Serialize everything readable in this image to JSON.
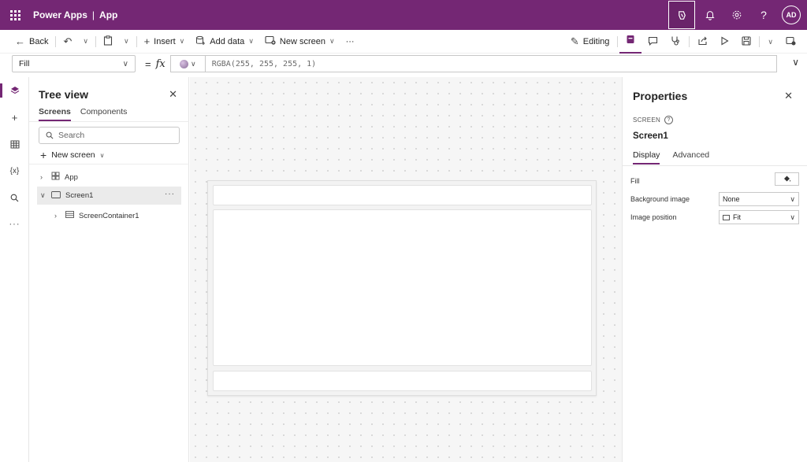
{
  "app": {
    "product": "Power Apps",
    "separator": "|",
    "name": "App",
    "user_initials": "AD"
  },
  "topbar_icons": [
    "copilot-icon",
    "bell-icon",
    "gear-icon",
    "help-icon"
  ],
  "toolbar": {
    "back": "Back",
    "insert": "Insert",
    "add_data": "Add data",
    "new_screen": "New screen",
    "more": "···",
    "editing": "Editing"
  },
  "formula": {
    "property": "Fill",
    "equals": "=",
    "fx": "fx",
    "value": "RGBA(255, 255, 255, 1)"
  },
  "rail": {
    "items": [
      "tree-view",
      "insert",
      "data",
      "variables",
      "search",
      "more"
    ]
  },
  "tree": {
    "title": "Tree view",
    "tabs": [
      "Screens",
      "Components"
    ],
    "active_tab": "Screens",
    "search_placeholder": "Search",
    "new_screen": "New screen",
    "nodes": {
      "app": "App",
      "screen": "Screen1",
      "container": "ScreenContainer1"
    },
    "more": "···"
  },
  "properties": {
    "title": "Properties",
    "kind": "SCREEN",
    "name": "Screen1",
    "tabs": [
      "Display",
      "Advanced"
    ],
    "active_tab": "Display",
    "fill_label": "Fill",
    "background_image_label": "Background image",
    "background_image_value": "None",
    "image_position_label": "Image position",
    "image_position_value": "Fit"
  },
  "colors": {
    "brand": "#742774",
    "canvas": "#f6f6f6"
  }
}
